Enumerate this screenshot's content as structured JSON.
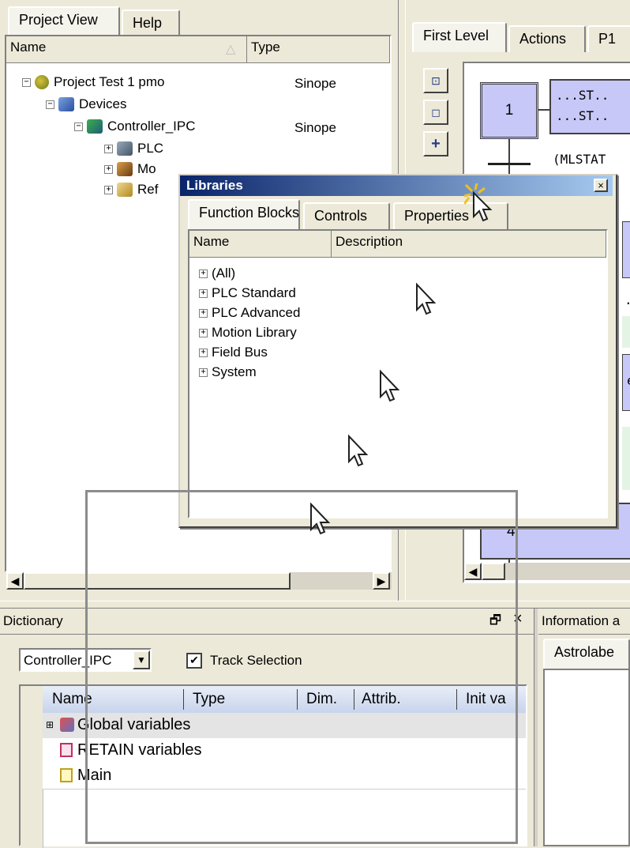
{
  "project": {
    "tabs": [
      "Project View",
      "Help"
    ],
    "columns": [
      "Name",
      "Type"
    ],
    "tree": [
      {
        "label": "Project Test 1 pmo",
        "type": "Sinope"
      },
      {
        "label": "Devices",
        "type": ""
      },
      {
        "label": "Controller_IPC",
        "type": "Sinope"
      },
      {
        "label": "PLC",
        "type": ""
      },
      {
        "label": "Mo",
        "type": ""
      },
      {
        "label": "Ref",
        "type": ""
      }
    ]
  },
  "editor": {
    "tabs": [
      "First Level",
      "Actions",
      "P1"
    ],
    "step_number": "1",
    "step_action_lines": [
      "...ST..",
      "...ST.."
    ],
    "transition_text": "(MLSTAT",
    "side_text_1": ".T",
    "side_text_2": "e",
    "step_number_4": "4"
  },
  "libraries": {
    "title": "Libraries",
    "close_glyph": "×",
    "tabs": [
      "Function Blocks",
      "Controls",
      "Properties"
    ],
    "columns": [
      "Name",
      "Description"
    ],
    "items": [
      "(All)",
      "PLC Standard",
      "PLC Advanced",
      "Motion Library",
      "Field Bus",
      "System"
    ]
  },
  "dictionary": {
    "title": "Dictionary",
    "pin_glyph": "🗗",
    "close_glyph": "×",
    "controller_value": "Controller_IPC",
    "track_label": "Track Selection",
    "track_checked": true,
    "columns": [
      "Name",
      "Type",
      "Dim.",
      "Attrib.",
      "Init va"
    ],
    "rows": [
      "Global variables",
      "RETAIN variables",
      "Main"
    ]
  },
  "information": {
    "title": "Information a",
    "tab": "Astrolabe"
  },
  "colors": {
    "titlebar_start": "#0a246a",
    "titlebar_end": "#a6caf0",
    "step_fill": "#c8c8f8",
    "selection_gray": "#8c8c8c"
  }
}
